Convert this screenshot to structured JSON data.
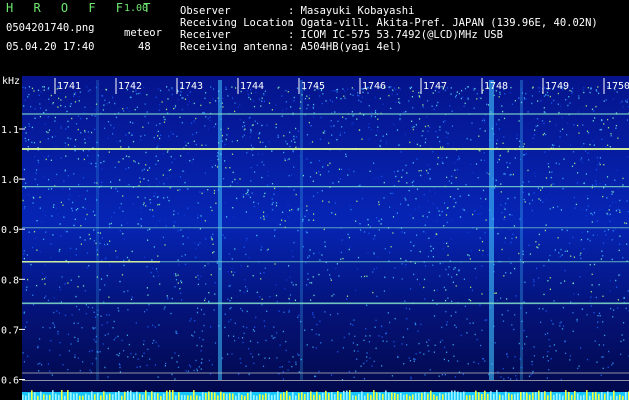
{
  "header": {
    "app_title": "H R O F F T",
    "version": "1.00",
    "filename": "0504201740.png",
    "meteor_label": "meteor",
    "datetime": "05.04.20 17:40",
    "meteor_count": "48",
    "info": [
      {
        "label": "Observer",
        "value": ": Masayuki Kobayashi"
      },
      {
        "label": "Receiving Location",
        "value": ": Ogata-vill. Akita-Pref. JAPAN (139.96E, 40.02N)"
      },
      {
        "label": "Receiver",
        "value": ": ICOM IC-575 53.7492(@LCD)MHz USB"
      },
      {
        "label": "Receiving antenna",
        "value": ": A504HB(yagi 4el)"
      }
    ]
  },
  "axis": {
    "unit": "kHz",
    "y_ticks": [
      "1.1",
      "1.0",
      "0.9",
      "0.8",
      "0.7",
      "0.6"
    ],
    "x_ticks": [
      "1741",
      "1742",
      "1743",
      "1744",
      "1745",
      "1746",
      "1747",
      "1748",
      "1749",
      "1750"
    ]
  },
  "colors": {
    "text_green": "#6fe86f",
    "text_white": "#ffffff",
    "signal_line": "#7bd8c8",
    "signal_bright": "#e0ff9a",
    "background": "#000000"
  }
}
